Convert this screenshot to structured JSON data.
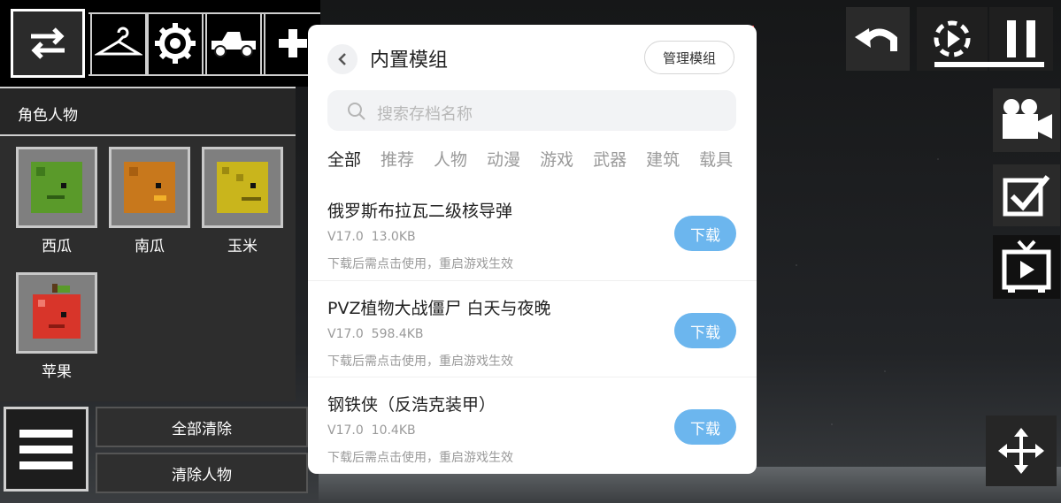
{
  "toolbar": {
    "icons": [
      "swap-arrows-icon",
      "hanger-icon",
      "gear-icon",
      "jeep-icon",
      "plus-icon"
    ]
  },
  "panel": {
    "title": "角色人物",
    "items": [
      {
        "label": "西瓜",
        "color": "#5a9a2a"
      },
      {
        "label": "南瓜",
        "color": "#c8781c"
      },
      {
        "label": "玉米",
        "color": "#c9b51c"
      },
      {
        "label": "苹果",
        "color": "#d8352a"
      }
    ]
  },
  "controls": {
    "clear_all": "全部清除",
    "clear_people": "清除人物"
  },
  "dialog": {
    "title": "内置模组",
    "manage_label": "管理模组",
    "search_placeholder": "搜索存档名称",
    "tabs": [
      "全部",
      "推荐",
      "人物",
      "动漫",
      "游戏",
      "武器",
      "建筑",
      "载具"
    ],
    "active_tab": 0,
    "download_label": "下载",
    "mods": [
      {
        "name": "俄罗斯布拉瓦二级核导弹",
        "version": "V17.0",
        "size": "13.0KB",
        "note": "下载后需点击使用，重启游戏生效"
      },
      {
        "name": "PVZ植物大战僵尸 白天与夜晚",
        "version": "V17.0",
        "size": "598.4KB",
        "note": "下载后需点击使用，重启游戏生效"
      },
      {
        "name": "钢铁侠（反浩克装甲）",
        "version": "V17.0",
        "size": "10.4KB",
        "note": "下载后需点击使用，重启游戏生效"
      }
    ]
  },
  "colors": {
    "accent": "#6cb6ee",
    "highlight": "#e43a3a"
  }
}
